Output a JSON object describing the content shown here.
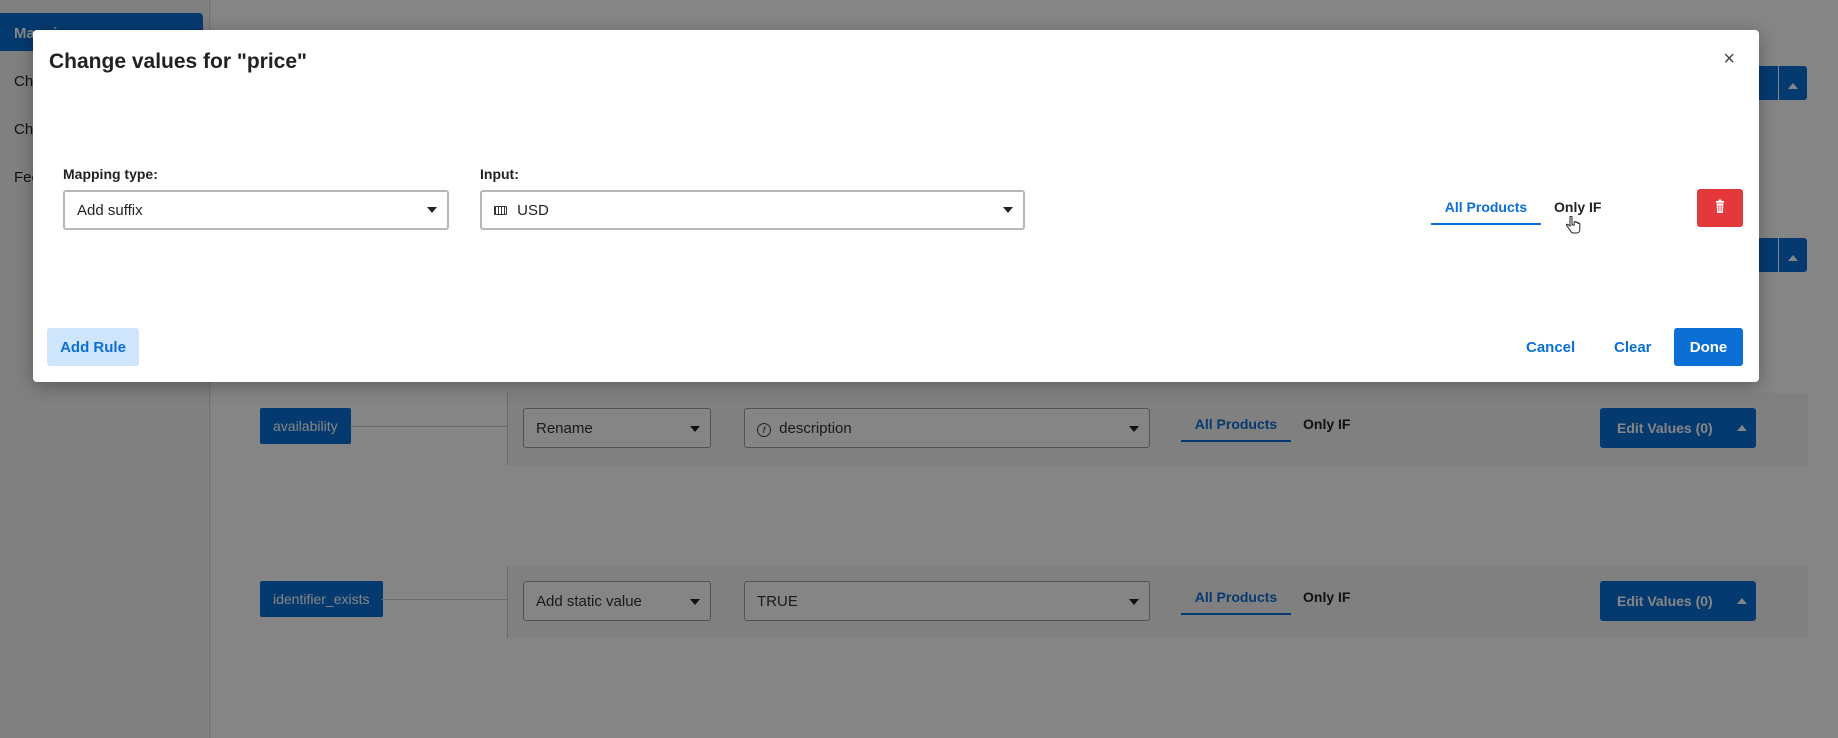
{
  "sidebar": {
    "active_label": "Mappings",
    "items": [
      {
        "label": "Ch"
      },
      {
        "label": "Ch"
      },
      {
        "label": "Fee"
      }
    ]
  },
  "background_rows": [
    {
      "field": "availability",
      "mapping_type": "Rename",
      "input_icon": "function-icon",
      "input_value": "description",
      "tab_all": "All Products",
      "tab_if": "Only IF",
      "edit_label": "Edit Values (0)"
    },
    {
      "field": "identifier_exists",
      "mapping_type": "Add static value",
      "input_value": "TRUE",
      "tab_all": "All Products",
      "tab_if": "Only IF",
      "edit_label": "Edit Values (0)"
    }
  ],
  "modal": {
    "title": "Change values for \"price\"",
    "close_glyph": "×",
    "mapping_type_label": "Mapping type:",
    "mapping_type_value": "Add suffix",
    "input_label": "Input:",
    "input_icon": "keyboard-icon",
    "input_value": "USD",
    "tab_all": "All Products",
    "tab_if": "Only IF",
    "add_rule": "Add Rule",
    "cancel": "Cancel",
    "clear": "Clear",
    "done": "Done"
  },
  "colors": {
    "primary": "#0b6fd6",
    "danger": "#e5383b",
    "add_rule_bg": "#cfe5fb"
  }
}
